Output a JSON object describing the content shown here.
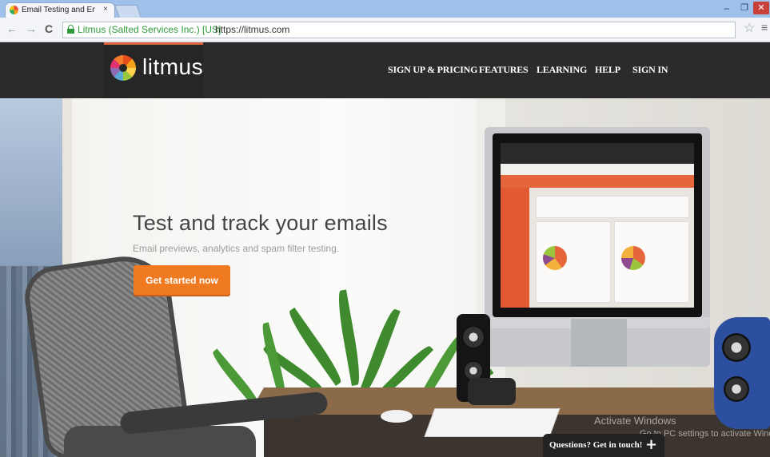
{
  "browser": {
    "tab_title": "Email Testing and Email M",
    "tab_close": "×",
    "secure_label": "Litmus (Salted Services Inc.) [US]",
    "url": "https://litmus.com",
    "back_icon": "←",
    "forward_icon": "→",
    "reload_icon": "C",
    "star_icon": "☆",
    "menu_icon": "≡",
    "win_min": "–",
    "win_max": "❐",
    "win_close": "✕"
  },
  "site": {
    "logo_text": "litmus",
    "nav": [
      {
        "label": "SIGN UP & PRICING"
      },
      {
        "label": "FEATURES"
      },
      {
        "label": "LEARNING"
      },
      {
        "label": "HELP"
      },
      {
        "label": "SIGN IN"
      }
    ]
  },
  "hero": {
    "title": "Test and track your emails",
    "subtitle": "Email previews, analytics and spam filter testing.",
    "cta_label": "Get started now"
  },
  "overlay": {
    "watermark_title": "Activate Windows",
    "watermark_sub": "Go to PC settings to activate Windows.",
    "chat_label": "Questions? Get in touch!",
    "chat_plus": "+"
  },
  "colors": {
    "header_bg": "#2b2b2b",
    "accent": "#ef7a22",
    "secure_green": "#2e9b3a"
  }
}
